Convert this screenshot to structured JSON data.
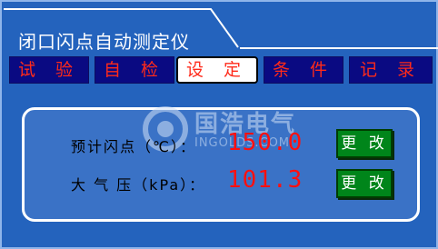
{
  "window": {
    "title": "闭口闪点自动测定仪"
  },
  "tabs": [
    {
      "label": "试 验"
    },
    {
      "label": "自 检"
    },
    {
      "label": "设 定",
      "active": true
    },
    {
      "label": "条 件"
    },
    {
      "label": "记 录"
    }
  ],
  "settings": {
    "flash_point_label": "预计闪点（℃）：",
    "flash_point_value": "150.0",
    "pressure_label": "大 气 压（kPa）：",
    "pressure_value": "101.3",
    "change_button_label": "更 改"
  },
  "watermark": {
    "text": "国浩电气",
    "sub": "INGOLDS.COM"
  },
  "colors": {
    "background": "#2463bd",
    "tab_bg": "#0a0a82",
    "tab_text": "#ff2a1a",
    "value_text": "#ff1010",
    "button_bg": "#00851a"
  }
}
